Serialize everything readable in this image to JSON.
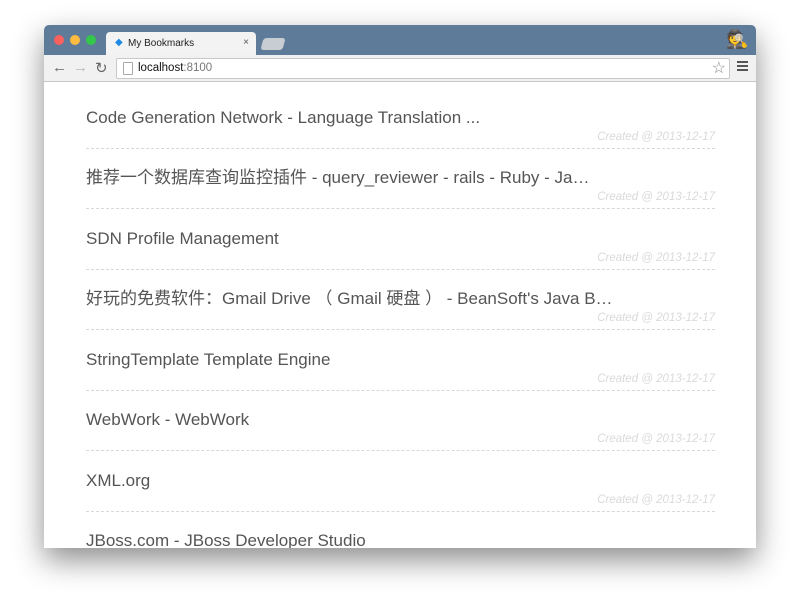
{
  "browser": {
    "tab_title": "My Bookmarks",
    "tab_close": "×",
    "url_host": "localhost",
    "url_port": ":8100",
    "traffic_lights": [
      "#fc605c",
      "#fdbc40",
      "#34c84a"
    ]
  },
  "bookmarks": [
    {
      "title": "Code Generation Network - Language Translation ...",
      "created": "Created @ 2013-12-17"
    },
    {
      "title": "推荐一个数据库查询监控插件 - query_reviewer - rails - Ruby - Ja…",
      "created": "Created @ 2013-12-17"
    },
    {
      "title": "SDN Profile Management",
      "created": "Created @ 2013-12-17"
    },
    {
      "title": "好玩的免费软件：Gmail Drive （ Gmail 硬盘 ） - BeanSoft's Java B…",
      "created": "Created @ 2013-12-17"
    },
    {
      "title": "StringTemplate Template Engine",
      "created": "Created @ 2013-12-17"
    },
    {
      "title": "WebWork - WebWork",
      "created": "Created @ 2013-12-17"
    },
    {
      "title": "XML.org",
      "created": "Created @ 2013-12-17"
    },
    {
      "title": "JBoss.com - JBoss Developer Studio",
      "created": ""
    }
  ]
}
